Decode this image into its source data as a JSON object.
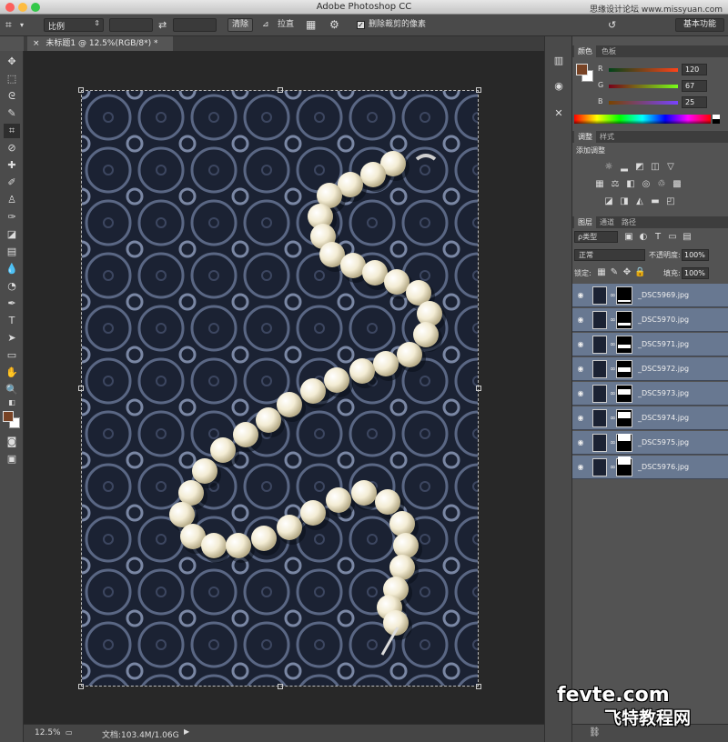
{
  "window": {
    "title": "Adobe Photoshop CC",
    "watermark_top": "思缘设计论坛 www.missyuan.com"
  },
  "options_bar": {
    "ratio_label": "比例",
    "clear_button": "清除",
    "straighten_label": "拉直",
    "delete_cropped_label": "删除裁剪的像素",
    "workspace_label": "基本功能"
  },
  "document": {
    "tab_label": "未标题1 @ 12.5%(RGB/8*) *"
  },
  "status_bar": {
    "zoom": "12.5%",
    "doc_info": "文档:103.4M/1.06G"
  },
  "color_panel": {
    "tabs": [
      "颜色",
      "色板"
    ],
    "r_label": "R",
    "g_label": "G",
    "b_label": "B",
    "r_value": "120",
    "g_value": "67",
    "b_value": "25",
    "fg_color": "#784325"
  },
  "adjust_panel": {
    "tabs": [
      "调整",
      "样式"
    ],
    "add_label": "添加调整"
  },
  "layers_panel": {
    "tabs": [
      "图层",
      "通道",
      "路径"
    ],
    "filter_label": "ρ类型",
    "blend_mode": "正常",
    "opacity_label": "不透明度:",
    "opacity_value": "100%",
    "lock_label": "锁定:",
    "fill_label": "填充:",
    "fill_value": "100%",
    "layers": [
      {
        "name": "_DSC5969.jpg"
      },
      {
        "name": "_DSC5970.jpg"
      },
      {
        "name": "_DSC5971.jpg"
      },
      {
        "name": "_DSC5972.jpg"
      },
      {
        "name": "_DSC5973.jpg"
      },
      {
        "name": "_DSC5974.jpg"
      },
      {
        "name": "_DSC5975.jpg"
      },
      {
        "name": "_DSC5976.jpg"
      }
    ]
  },
  "watermark_bottom": {
    "site": "fevte.com",
    "caption": "飞特教程网"
  }
}
